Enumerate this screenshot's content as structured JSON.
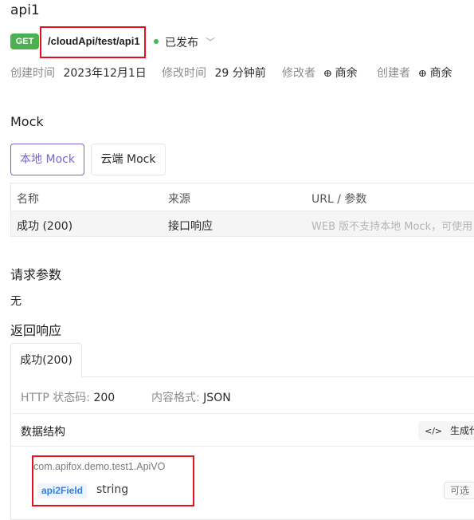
{
  "api": {
    "name": "api1",
    "method": "GET",
    "path": "/cloudApi/test/api1",
    "status": "已发布"
  },
  "meta": {
    "created_label": "创建时间",
    "created_value": "2023年12月1日",
    "modified_label": "修改时间",
    "modified_value": "29 分钟前",
    "modifier_label": "修改者",
    "modifier_value": "商余",
    "creator_label": "创建者",
    "creator_value": "商余"
  },
  "mock": {
    "heading": "Mock",
    "tabs": [
      {
        "label": "本地 Mock",
        "active": true
      },
      {
        "label": "云端 Mock",
        "active": false
      }
    ],
    "columns": [
      "名称",
      "来源",
      "URL / 参数"
    ],
    "rows": [
      {
        "name": "成功 (200)",
        "source": "接口响应",
        "url": "WEB 版不支持本地 Mock，可使用"
      }
    ]
  },
  "request": {
    "heading": "请求参数",
    "value": "无"
  },
  "response": {
    "heading": "返回响应",
    "tab_label": "成功(200)",
    "http_code_label": "HTTP 状态码:",
    "http_code_value": "200",
    "format_label": "内容格式:",
    "format_value": "JSON",
    "structure_heading": "数据结构",
    "generate_code_label": "生成代码",
    "schema_class": "com.apifox.demo.test1.ApiVO",
    "field_name": "api2Field",
    "field_type": "string",
    "optional_label": "可选"
  },
  "colors": {
    "method_get": "#4caf50",
    "accent": "#7b61d8",
    "published_dot": "#3fb950",
    "highlight_box": "#e3111a",
    "field_tag": "#2f7fe0"
  },
  "icons": [
    "status-dot-icon",
    "chevron-down-icon",
    "user-icon",
    "code-icon"
  ]
}
